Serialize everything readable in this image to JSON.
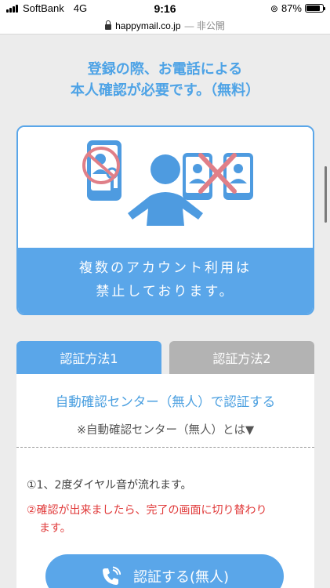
{
  "status_bar": {
    "carrier": "SoftBank",
    "network": "4G",
    "time": "9:16",
    "battery": "87%",
    "battery_level": 0.87
  },
  "url_bar": {
    "domain": "happymail.co.jp",
    "suffix": "— 非公開"
  },
  "headline": {
    "line1": "登録の際、お電話による",
    "line2": "本人確認が必要です。（無料）"
  },
  "card": {
    "caption_line1": "複数のアカウント利用は",
    "caption_line2": "禁止しております。",
    "colors": {
      "accent": "#5aa6e9",
      "cross": "#e07f88"
    }
  },
  "tabs": [
    {
      "label": "認証方法1",
      "active": true
    },
    {
      "label": "認証方法2",
      "active": false
    }
  ],
  "method": {
    "title": "自動確認センター（無人）で認証する",
    "info_link": "※自動確認センター（無人）とは▼",
    "step1": "①1、2度ダイヤル音が流れます。",
    "step2_line1": "②確認が出来ましたら、完了の画面に切り替わり",
    "step2_line2": "ます。",
    "button_label": "認証する(無人)",
    "button_icon": "phone-icon"
  }
}
